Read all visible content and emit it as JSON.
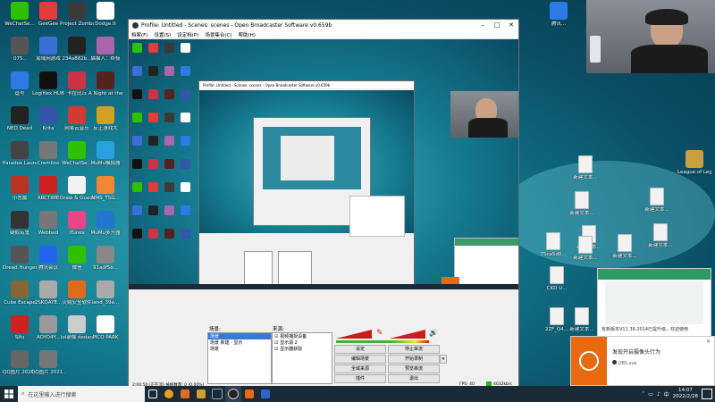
{
  "desktop_icons": [
    {
      "label": "WeChatSe...",
      "color": "#2dc100"
    },
    {
      "label": "GeeGee",
      "color": "#e63b3b"
    },
    {
      "label": "Project Zomboid",
      "color": "#3a3a3a"
    },
    {
      "label": "Dodge.It",
      "color": "#ffffff"
    },
    {
      "label": "075..",
      "color": "#555555"
    },
    {
      "label": "局域网游戏",
      "color": "#3b6fd8"
    },
    {
      "label": "234a882b...",
      "color": "#222222"
    },
    {
      "label": "猫猫人：终极",
      "color": "#aa66aa"
    },
    {
      "label": "逗号",
      "color": "#2f7be5"
    },
    {
      "label": "LogiHex HUB",
      "color": "#111111"
    },
    {
      "label": "卡拉比丘",
      "color": "#cc3344"
    },
    {
      "label": "A Night at the Dance",
      "color": "#552222"
    },
    {
      "label": "NEO Dead",
      "color": "#222222"
    },
    {
      "label": "Krita",
      "color": "#3355aa"
    },
    {
      "label": "网易云音乐",
      "color": "#d33a31"
    },
    {
      "label": "反正游戏大",
      "color": "#d4a020"
    },
    {
      "label": "Paradox Launcher",
      "color": "#444444"
    },
    {
      "label": "Cremlins",
      "color": "#777777"
    },
    {
      "label": "WeChatSe...",
      "color": "#2dc100"
    },
    {
      "label": "MuMu模拟器",
      "color": "#2aa0e0"
    },
    {
      "label": "小恶魔",
      "color": "#bb3322"
    },
    {
      "label": "ARCTIME",
      "color": "#cc2222"
    },
    {
      "label": "Draw & Guess",
      "color": "#f2f2f2"
    },
    {
      "label": "NMS_TSG...",
      "color": "#ee8833"
    },
    {
      "label": "疑似有鬼",
      "color": "#333333"
    },
    {
      "label": "Webbed",
      "color": "#777777"
    },
    {
      "label": "iTunes",
      "color": "#ee4488"
    },
    {
      "label": "MuMu多开器",
      "color": "#2277cc"
    },
    {
      "label": "Dread Hunger",
      "color": "#555555"
    },
    {
      "label": "腾讯会议",
      "color": "#2266ee"
    },
    {
      "label": "微信",
      "color": "#2dc100"
    },
    {
      "label": "91adf5b...",
      "color": "#888888"
    },
    {
      "label": "Cube Escape",
      "color": "#886633"
    },
    {
      "label": "2SKQAYE...",
      "color": "#aaaaaa"
    },
    {
      "label": "火绒安全软件",
      "color": "#e06a1b"
    },
    {
      "label": "land_39a...",
      "color": "#aaaaaa"
    },
    {
      "label": "Sifu",
      "color": "#cc2222"
    },
    {
      "label": "AOYO4Y...",
      "color": "#999999"
    },
    {
      "label": "lol录像 dedao",
      "color": "#cccccc"
    },
    {
      "label": "PICO PARK",
      "color": "#ffffff"
    },
    {
      "label": "QQ图片 2021...",
      "color": "#666666"
    },
    {
      "label": "QQ图片 2021...",
      "color": "#777777"
    }
  ],
  "right_icons": [
    {
      "label": "新建 文本...",
      "kind": "file"
    },
    {
      "label": "League of Legends",
      "kind": "app",
      "color": "#c8a040"
    },
    {
      "label": "新建文本...",
      "kind": "file"
    },
    {
      "label": "新建文本...",
      "kind": "file"
    },
    {
      "label": "新建文本...",
      "kind": "file"
    },
    {
      "label": "新建文本...",
      "kind": "file"
    },
    {
      "label": "新建文本...",
      "kind": "file"
    },
    {
      "label": "75ca5d0...",
      "kind": "file"
    },
    {
      "label": "新建文本...",
      "kind": "file"
    },
    {
      "label": "新建文本...",
      "kind": "file"
    },
    {
      "label": "CKD U...",
      "kind": "file"
    },
    {
      "label": "新建文本...",
      "kind": "file"
    },
    {
      "label": "2ZF_Q4...",
      "kind": "file"
    }
  ],
  "top_right_icon": {
    "label": "腾讯...",
    "color": "#2f7be5"
  },
  "obs": {
    "title": "Profile: Untitled - Scenes: scenes - Open Broadcaster Software v0.659b",
    "menu": [
      "档案(F)",
      "设置(S)",
      "设定档(P)",
      "场景集合(C)",
      "帮助(H)"
    ],
    "scenes_label": "场景:",
    "scenes": [
      "场景",
      "场景 新建 · 显示",
      "场景"
    ],
    "sources_label": "来源:",
    "sources": [
      "视频捕捉设备",
      "显示源 2",
      "显示器获取"
    ],
    "buttons": {
      "settings": "设定",
      "stop_stream": "停止串流",
      "edit_scene": "编辑场景",
      "start_record": "开始录制",
      "global_sources": "全域来源",
      "preview": "预览串流",
      "plugins": "插件",
      "exit": "退出"
    },
    "status": "2:00:50 (正在流) 掉帧数量: 0 (0.00%)",
    "fps": "FPS: 40",
    "kbps": "4032kb/s"
  },
  "obs_inner_title": "Profile: Untitled - Scenes: scenes - Open Broadcaster Software v0.659b",
  "desktop_window_title": "已在后台运行",
  "update_notice": {
    "text": "有新版本V11.39.2014已提升级，欢迎使用"
  },
  "obs_notification": {
    "title": "发现开启摄像头行为",
    "app": "OBS.exe"
  },
  "taskbar": {
    "search_placeholder": "在这里输入进行搜索",
    "time": "14:07",
    "date": "2022/2/28",
    "ime": "中"
  },
  "colors": {
    "accent": "#e86a10",
    "taskbar": "#1a2a36"
  }
}
